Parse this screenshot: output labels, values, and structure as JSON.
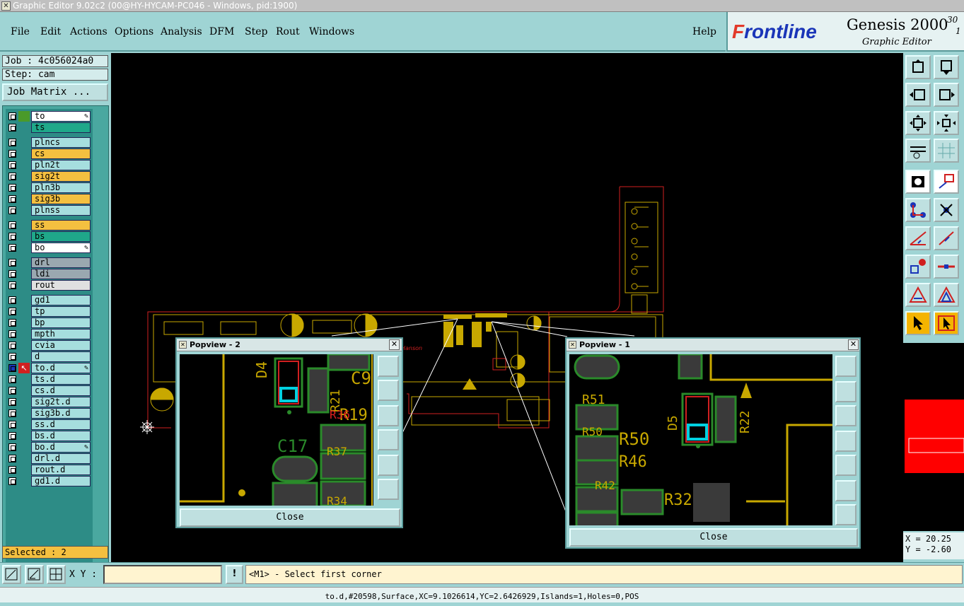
{
  "window": {
    "title": "Graphic Editor 9.02c2 (00@HY-HYCAM-PC046 - Windows, pid:1900)"
  },
  "menu": [
    "File",
    "Edit",
    "Actions",
    "Options",
    "Analysis",
    "DFM",
    "Step",
    "Rout",
    "Windows"
  ],
  "help": "Help",
  "brand": {
    "logo_f": "F",
    "logo_rest": "rontline",
    "product": "Genesis 2000",
    "version": "30",
    "version2": "1",
    "subtitle": "Graphic Editor"
  },
  "job": "Job : 4c056024a0",
  "step": "Step: cam",
  "job_matrix": "Job Matrix ...",
  "layers": [
    {
      "name": "to",
      "color": "#ffffff",
      "pin": true,
      "sel": "#4a9a2a"
    },
    {
      "name": "ts",
      "color": "#1fa88a"
    },
    {
      "name": "plncs",
      "color": "#a6dede"
    },
    {
      "name": "cs",
      "color": "#f4c040"
    },
    {
      "name": "pln2t",
      "color": "#a6dede"
    },
    {
      "name": "sig2t",
      "color": "#f4c040"
    },
    {
      "name": "pln3b",
      "color": "#a6dede"
    },
    {
      "name": "sig3b",
      "color": "#f4c040"
    },
    {
      "name": "plnss",
      "color": "#a6dede"
    },
    {
      "name": "ss",
      "color": "#f4c040"
    },
    {
      "name": "bs",
      "color": "#1fa88a"
    },
    {
      "name": "bo",
      "color": "#ffffff",
      "pin": true
    },
    {
      "name": "drl",
      "color": "#9aa8b0"
    },
    {
      "name": "ldi",
      "color": "#9aa8b0"
    },
    {
      "name": "rout",
      "color": "#e0e0e0"
    },
    {
      "name": "gd1",
      "color": "#a6dede"
    },
    {
      "name": "tp",
      "color": "#a6dede"
    },
    {
      "name": "bp",
      "color": "#a6dede"
    },
    {
      "name": "mpth",
      "color": "#a6dede"
    },
    {
      "name": "cvia",
      "color": "#a6dede"
    },
    {
      "name": "d",
      "color": "#a6dede"
    },
    {
      "name": "to.d",
      "color": "#a6dede",
      "pin": true,
      "active": true
    },
    {
      "name": "ts.d",
      "color": "#a6dede"
    },
    {
      "name": "cs.d",
      "color": "#a6dede"
    },
    {
      "name": "sig2t.d",
      "color": "#a6dede"
    },
    {
      "name": "sig3b.d",
      "color": "#a6dede"
    },
    {
      "name": "ss.d",
      "color": "#a6dede"
    },
    {
      "name": "bs.d",
      "color": "#a6dede"
    },
    {
      "name": "bo.d",
      "color": "#a6dede",
      "pin": true
    },
    {
      "name": "drl.d",
      "color": "#a6dede"
    },
    {
      "name": "rout.d",
      "color": "#a6dede"
    },
    {
      "name": "gd1.d",
      "color": "#a6dede"
    }
  ],
  "selected": "Selected : 2",
  "xy_label": "X Y :",
  "xy_value": "",
  "warn": "!",
  "prompt": "<M1> - Select first corner",
  "status": "to.d,#20598,Surface,XC=9.1026614,YC=2.6426929,Islands=1,Holes=0,POS",
  "coords": {
    "x": "X = 20.25",
    "y": "Y = -2.60"
  },
  "popview2": {
    "title": "Popview - 2",
    "close": "Close",
    "labels": [
      "D4",
      "C9",
      "R21",
      "R19",
      "R36",
      "C17",
      "R37",
      "R34"
    ]
  },
  "popview1": {
    "title": "Popview - 1",
    "close": "Close",
    "labels": [
      "R51",
      "R50",
      "R50",
      "R46",
      "D5",
      "R22",
      "R42",
      "R32"
    ]
  },
  "colors": {
    "trace": "#c8a800",
    "pad": "#2a8a2a",
    "outline": "#d02020",
    "accent": "#00d0e0"
  }
}
